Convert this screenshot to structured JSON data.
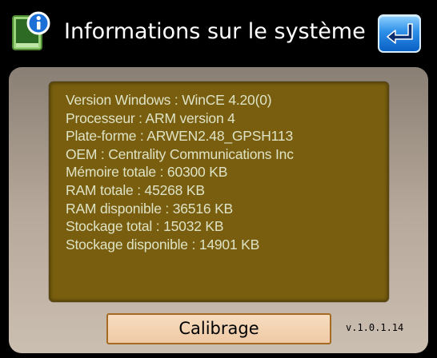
{
  "titlebar": {
    "title": "Informations sur le système",
    "app_icon": "info-device-icon",
    "back_icon": "return-arrow-icon"
  },
  "info": {
    "lines": [
      "Version Windows : WinCE 4.20(0)",
      "Processeur : ARM version 4",
      "Plate-forme : ARWEN2.48_GPSH113",
      "OEM : Centrality Communications Inc",
      "Mémoire totale : 60300 KB",
      "RAM totale : 45268 KB",
      "RAM disponible : 36516 KB",
      "Stockage total : 15032 KB",
      "Stockage disponible : 14901 KB"
    ]
  },
  "footer": {
    "calibrate_label": "Calibrage",
    "version": "v.1.0.1.14"
  },
  "colors": {
    "background": "#000000",
    "panel": "#b6a89a",
    "info_box": "#785e0e",
    "info_text": "#dfe3c6",
    "accent_blue": "#2d8fe8",
    "calibrate_button": "#f2d0ae"
  }
}
